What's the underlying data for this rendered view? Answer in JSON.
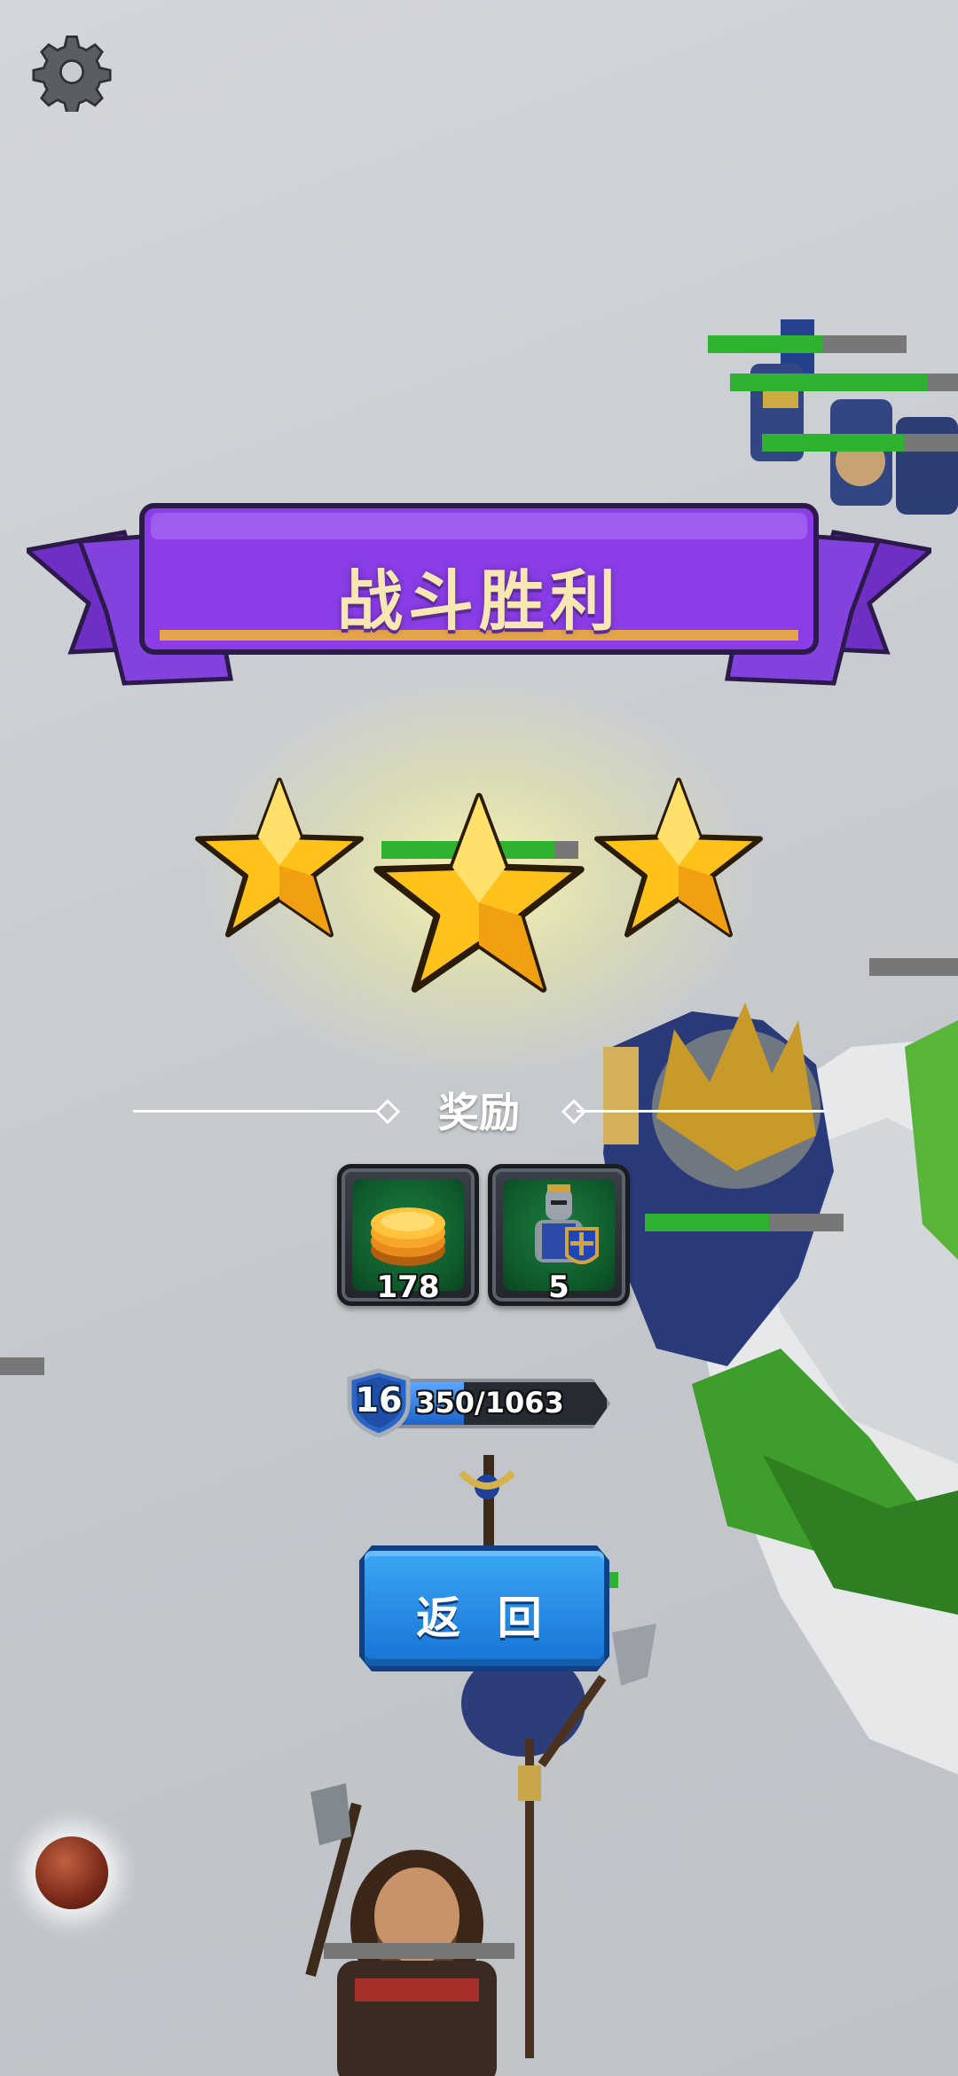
{
  "hud": {
    "settings_icon": "gear-icon"
  },
  "result": {
    "title": "战斗胜利",
    "stars_earned": 3,
    "stars_total": 3
  },
  "rewards": {
    "label": "奖励",
    "items": [
      {
        "icon": "gold-coins-icon",
        "count": "178"
      },
      {
        "icon": "knight-unit-icon",
        "count": "5"
      }
    ]
  },
  "player": {
    "level": "16",
    "xp_text": "350/1063",
    "xp_current": 350,
    "xp_max": 1063
  },
  "actions": {
    "return_label": "返 回"
  },
  "colors": {
    "banner": "#8b3ee8",
    "button": "#1f82e0",
    "star": "#ffc21a",
    "reward_bg": "#137040",
    "hp": "#2fb22f"
  }
}
